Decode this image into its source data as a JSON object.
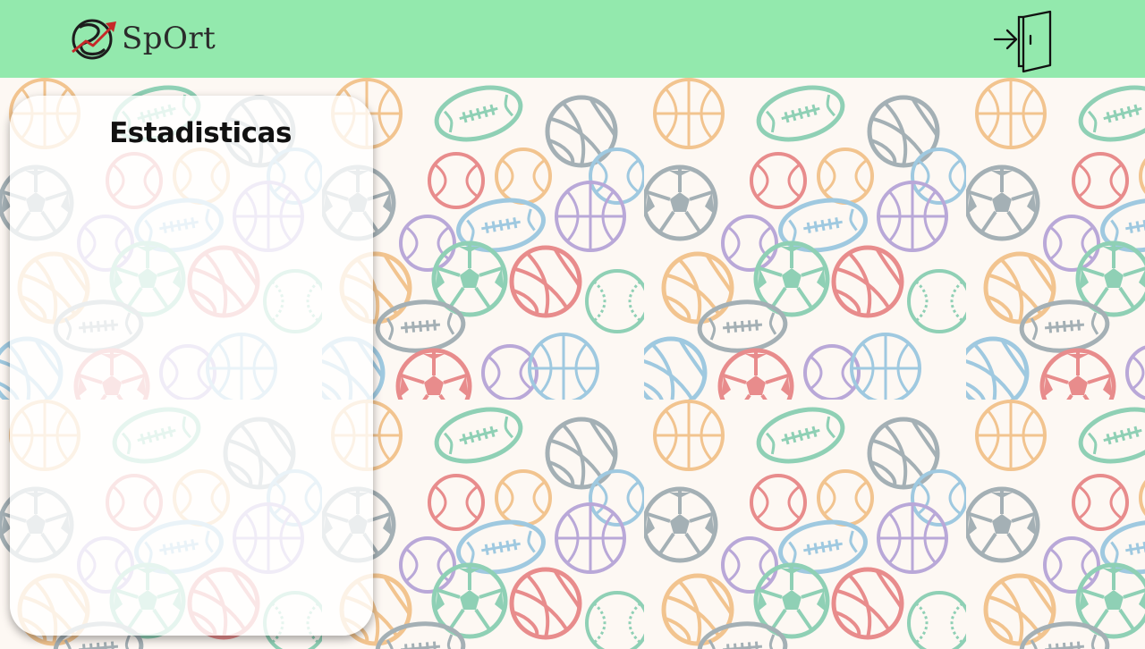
{
  "header": {
    "brand_name": "SpOrt",
    "logo_icon": "sport-logo-icon",
    "logout_icon": "logout-door-icon",
    "background_color": "#93e9ad"
  },
  "stats_panel": {
    "title": "Estadisticas"
  },
  "background": {
    "pattern": "sports-balls-pattern",
    "colors": [
      "#e88c8c",
      "#8fd0b5",
      "#f2c48f",
      "#9fc9e0",
      "#b9a8d8",
      "#a4b0b5"
    ]
  }
}
